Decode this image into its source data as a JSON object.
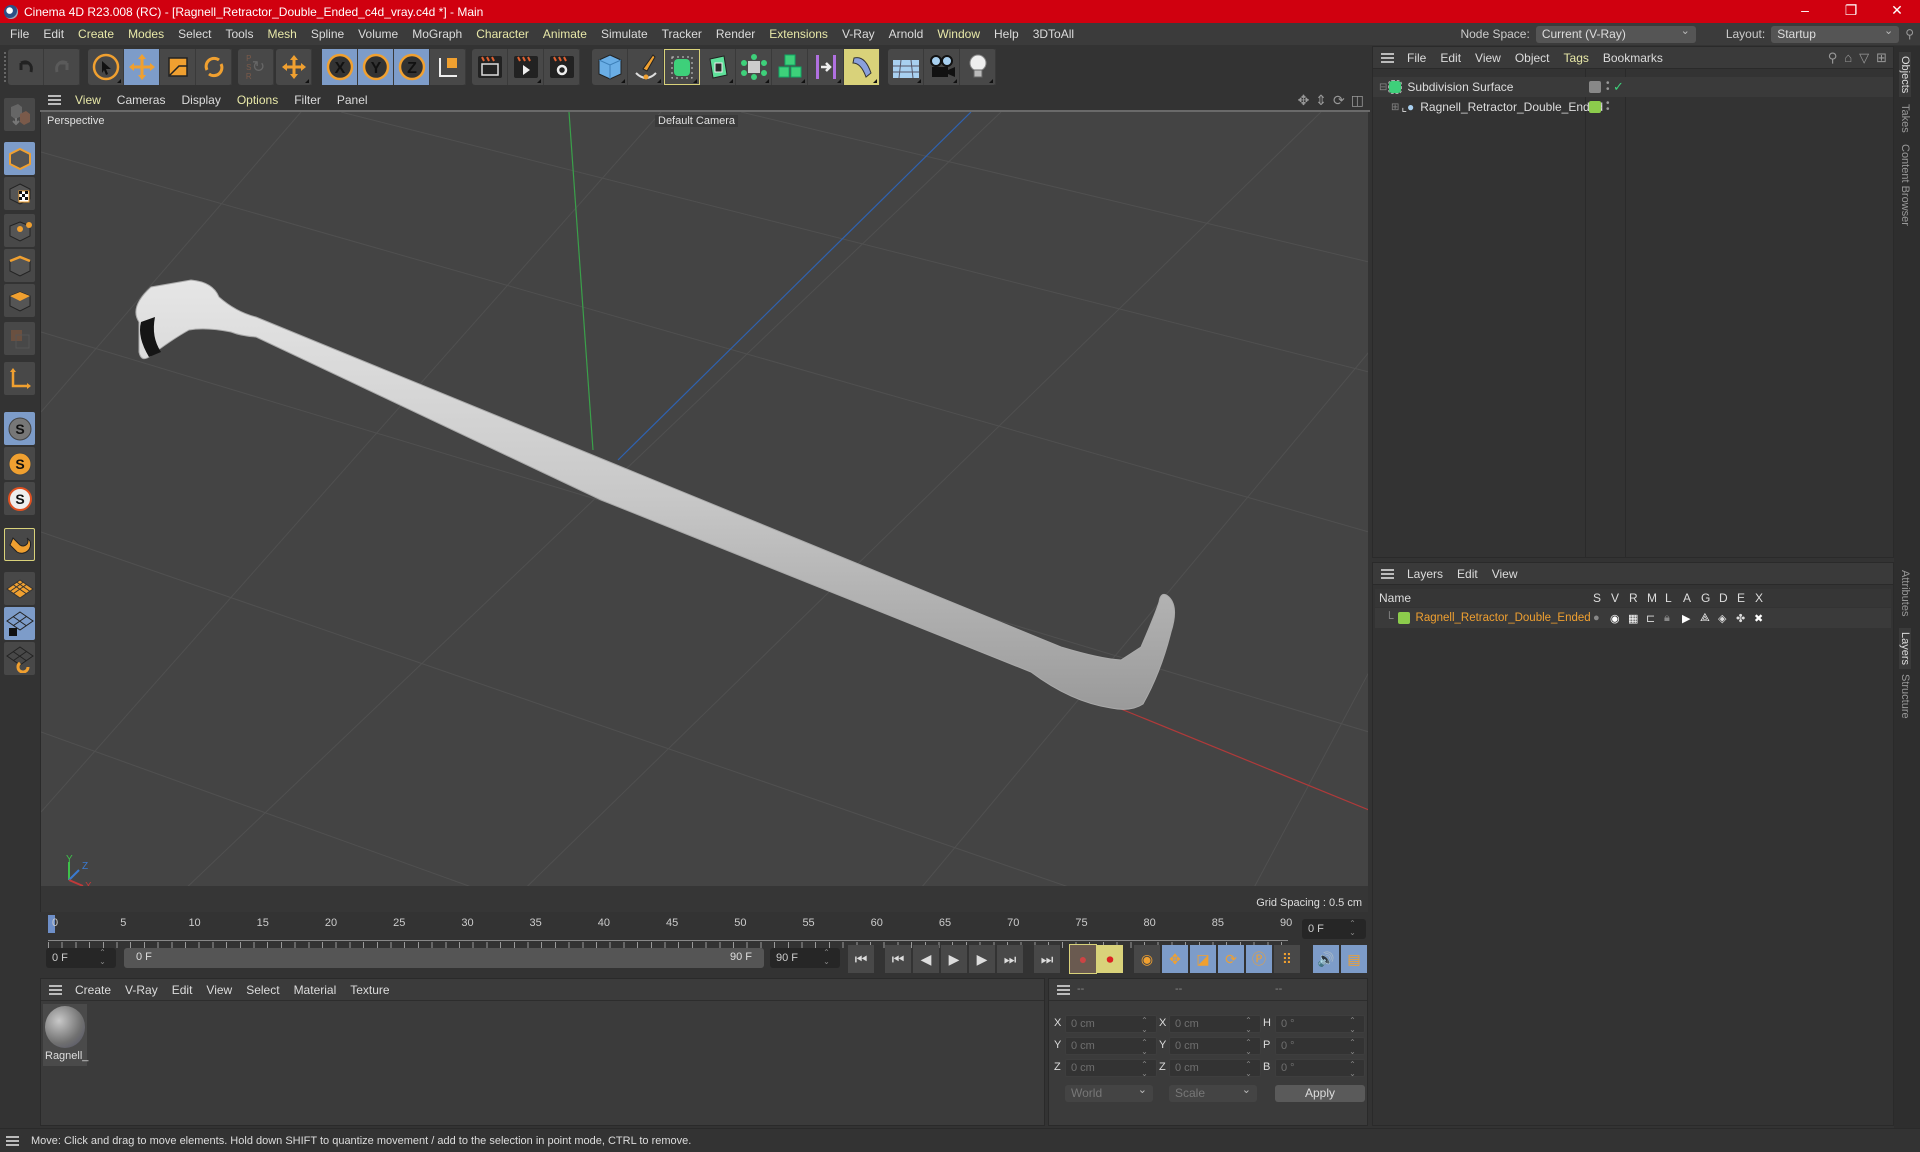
{
  "window": {
    "title": "Cinema 4D R23.008 (RC) - [Ragnell_Retractor_Double_Ended_c4d_vray.c4d *] - Main",
    "controls": [
      "minimize",
      "restore",
      "close"
    ]
  },
  "menubar": {
    "items": [
      "File",
      "Edit",
      "Create",
      "Modes",
      "Select",
      "Tools",
      "Mesh",
      "Spline",
      "Volume",
      "MoGraph",
      "Character",
      "Animate",
      "Simulate",
      "Tracker",
      "Render",
      "Extensions",
      "V-Ray",
      "Arnold",
      "Window",
      "Help",
      "3DToAll"
    ],
    "highlighted": [
      "Create",
      "Modes",
      "Mesh",
      "Character",
      "Animate",
      "Extensions",
      "Window"
    ],
    "node_space_label": "Node Space:",
    "node_space_value": "Current (V-Ray)",
    "layout_label": "Layout:",
    "layout_value": "Startup"
  },
  "toolbar": {
    "groups": [
      [
        "undo-icon",
        "redo-icon"
      ],
      [
        "select-pointer-icon",
        "move-icon",
        "scale-icon",
        "rotate-icon"
      ],
      [
        "psr-icon"
      ],
      [
        "move-axis-icon"
      ],
      [
        "x-axis-icon",
        "y-axis-icon",
        "z-axis-icon",
        "coordinate-system-icon"
      ],
      [
        "render-view-icon",
        "render-picture-viewer-icon",
        "render-settings-icon"
      ],
      [
        "cube-icon",
        "pen-spline-icon",
        "subdivision-surface-icon",
        "extrude-icon",
        "array-icon",
        "cloner-icon",
        "deformer-icon",
        "bend-icon"
      ],
      [
        "floor-icon",
        "camera-icon",
        "light-icon"
      ]
    ]
  },
  "left_tools": [
    "make-editable-icon",
    "model-mode-icon",
    "texture-mode-icon",
    "points-mode-icon",
    "edges-mode-icon",
    "polygons-mode-icon",
    "uv-mode-icon",
    "axis-mode-icon",
    "snap-icon",
    "snap-settings-icon",
    "quantize-icon",
    "magnet-icon",
    "workplane-icon",
    "locked-workplane-icon",
    "workplane-align-icon"
  ],
  "viewport": {
    "menu": [
      "View",
      "Cameras",
      "Display",
      "Options",
      "Filter",
      "Panel"
    ],
    "menu_highlighted": [
      "View",
      "Options"
    ],
    "projection": "Perspective",
    "camera": "Default Camera",
    "grid_spacing": "Grid Spacing : 0.5 cm",
    "axis_labels": {
      "x": "X",
      "y": "Y",
      "z": "Z"
    }
  },
  "timeline": {
    "ticks": [
      "0",
      "5",
      "10",
      "15",
      "20",
      "25",
      "30",
      "35",
      "40",
      "45",
      "50",
      "55",
      "60",
      "65",
      "70",
      "75",
      "80",
      "85",
      "90"
    ],
    "current_frame": "0 F",
    "start_frame": "0 F",
    "range_start": "0 F",
    "range_end": "90 F",
    "end_frame": "90 F"
  },
  "material_panel": {
    "menu": [
      "Create",
      "V-Ray",
      "Edit",
      "View",
      "Select",
      "Material",
      "Texture"
    ],
    "materials": [
      {
        "name": "Ragnell_"
      }
    ]
  },
  "coordinates": {
    "headers": [
      "--",
      "--",
      "--"
    ],
    "position": [
      {
        "axis": "X",
        "value": "0 cm"
      },
      {
        "axis": "Y",
        "value": "0 cm"
      },
      {
        "axis": "Z",
        "value": "0 cm"
      }
    ],
    "size": [
      {
        "axis": "X",
        "value": "0 cm"
      },
      {
        "axis": "Y",
        "value": "0 cm"
      },
      {
        "axis": "Z",
        "value": "0 cm"
      }
    ],
    "rotation": [
      {
        "axis": "H",
        "value": "0 °"
      },
      {
        "axis": "P",
        "value": "0 °"
      },
      {
        "axis": "B",
        "value": "0 °"
      }
    ],
    "space": "World",
    "mode": "Scale",
    "apply_label": "Apply"
  },
  "objects_panel": {
    "menu": [
      "File",
      "Edit",
      "View",
      "Object",
      "Tags",
      "Bookmarks"
    ],
    "menu_highlighted": [
      "Tags"
    ],
    "objects": [
      {
        "name": "Subdivision Surface",
        "icon": "subdivision-surface-icon",
        "enabled": true
      },
      {
        "name": "Ragnell_Retractor_Double_Ended",
        "icon": "polygon-object-icon",
        "layer_color": "#8ccc4c"
      }
    ]
  },
  "layers_panel": {
    "menu": [
      "Layers",
      "Edit",
      "View"
    ],
    "columns": [
      "Name",
      "S",
      "V",
      "R",
      "M",
      "L",
      "A",
      "G",
      "D",
      "E",
      "X"
    ],
    "layers": [
      {
        "name": "Ragnell_Retractor_Double_Ended",
        "color": "#8ccc4c"
      }
    ]
  },
  "right_tabs": {
    "top": [
      "Objects",
      "Takes",
      "Content Browser"
    ],
    "bottom": [
      "Attributes",
      "Layers",
      "Structure"
    ],
    "active": [
      "Objects",
      "Layers"
    ]
  },
  "status": "Move: Click and drag to move elements. Hold down SHIFT to quantize movement / add to the selection in point mode, CTRL to remove.",
  "colors": {
    "titlebar": "#d0000f",
    "accent_blue": "#7d9cc9",
    "accent_orange": "#f0a030",
    "layer_green": "#8ccc4c",
    "highlight_yellow": "#d9d27a"
  }
}
